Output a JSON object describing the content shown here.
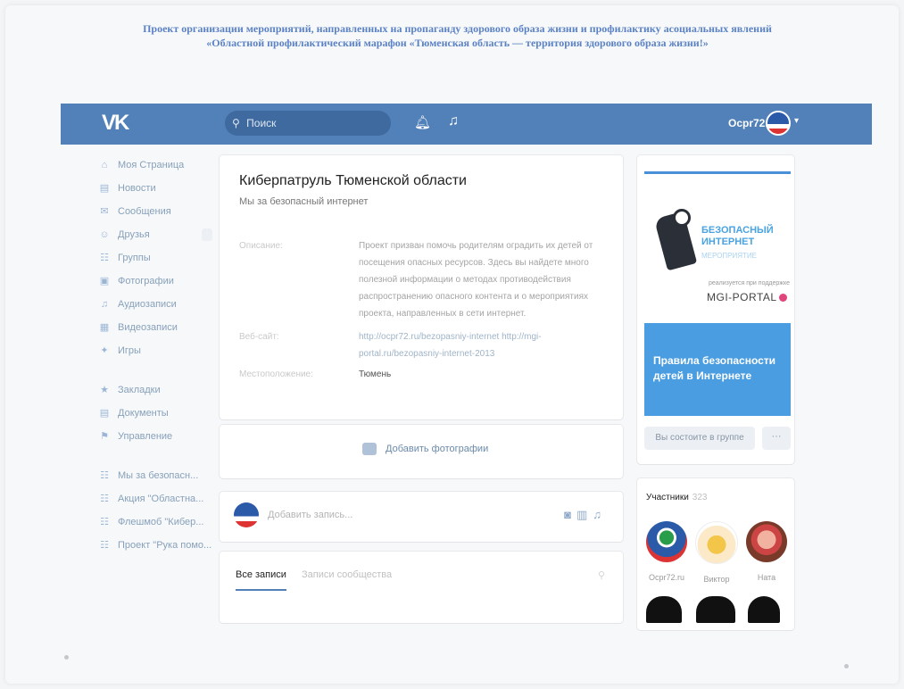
{
  "caption": {
    "line1": "Проект организации мероприятий, направленных на пропаганду здорового образа жизни и профилактику асоциальных явлений",
    "line2": "«Областной профилактический марафон «Тюменская область — территория здорового образа жизни!»"
  },
  "header": {
    "logo": "VK",
    "search_placeholder": "Поиск",
    "site_name": "Ocpr72.ru"
  },
  "menu": {
    "items": [
      {
        "label": "Моя Страница",
        "icon": "home-icon",
        "glyph": "⌂"
      },
      {
        "label": "Новости",
        "icon": "news-icon",
        "glyph": "▤"
      },
      {
        "label": "Сообщения",
        "icon": "messages-icon",
        "glyph": "✉"
      },
      {
        "label": "Друзья",
        "icon": "friends-icon",
        "glyph": "☺"
      },
      {
        "label": "Группы",
        "icon": "groups-icon",
        "glyph": "☷"
      },
      {
        "label": "Фотографии",
        "icon": "photos-icon",
        "glyph": "▣"
      },
      {
        "label": "Аудиозаписи",
        "icon": "music-icon",
        "glyph": "♫"
      },
      {
        "label": "Видеозаписи",
        "icon": "video-icon",
        "glyph": "▦"
      },
      {
        "label": "Игры",
        "icon": "games-icon",
        "glyph": "✦"
      }
    ],
    "items2": [
      {
        "label": "Закладки",
        "icon": "bookmarks-icon",
        "glyph": "★"
      },
      {
        "label": "Документы",
        "icon": "documents-icon",
        "glyph": "▤"
      },
      {
        "label": "Управление",
        "icon": "manage-icon",
        "glyph": "⚑"
      }
    ],
    "items3": [
      {
        "label": "Мы за безопасн...",
        "icon": "community-icon",
        "glyph": "☷"
      },
      {
        "label": "Акция \"Областна...",
        "icon": "community-icon",
        "glyph": "☷"
      },
      {
        "label": "Флешмоб \"Кибер...",
        "icon": "community-icon",
        "glyph": "☷"
      },
      {
        "label": "Проект \"Рука помо...",
        "icon": "community-icon",
        "glyph": "☷"
      }
    ]
  },
  "group": {
    "title": "Киберпатруль Тюменской области",
    "status": "Мы за безопасный интернет",
    "desc_label": "Описание:",
    "desc_value": "Проект призван помочь родителям оградить их детей от посещения опасных ресурсов. Здесь вы найдете много полезной информации о методах противодействия распространению опасного контента и о мероприятиях проекта, направленных в сети интернет.",
    "site_label": "Веб-сайт:",
    "site_value": "http://ocpr72.ru/bezopasniy-internet http://mgi-portal.ru/bezopasniy-internet-2013",
    "location_label": "Местоположение:",
    "location_value": "Тюмень",
    "add_photos": "Добавить фотографии"
  },
  "post": {
    "placeholder": "Добавить запись...",
    "tab_all": "Все записи",
    "tab_other": "Записи сообщества"
  },
  "banner": {
    "heading": "БЕЗОПАСНЫЙ ИНТЕРНЕТ",
    "sub": "МЕРОПРИЯТИЕ",
    "small": "реализуется при поддержке",
    "brand": "MGI-PORTAL",
    "blue_text": "Правила безопасности детей в Интернете"
  },
  "actions": {
    "join": "Вы состоите в группе",
    "more": "···"
  },
  "members": {
    "title": "Участники",
    "count": "323",
    "list": [
      {
        "name": "Ocpr72.ru"
      },
      {
        "name": "Виктор"
      },
      {
        "name": "Ната"
      }
    ]
  }
}
